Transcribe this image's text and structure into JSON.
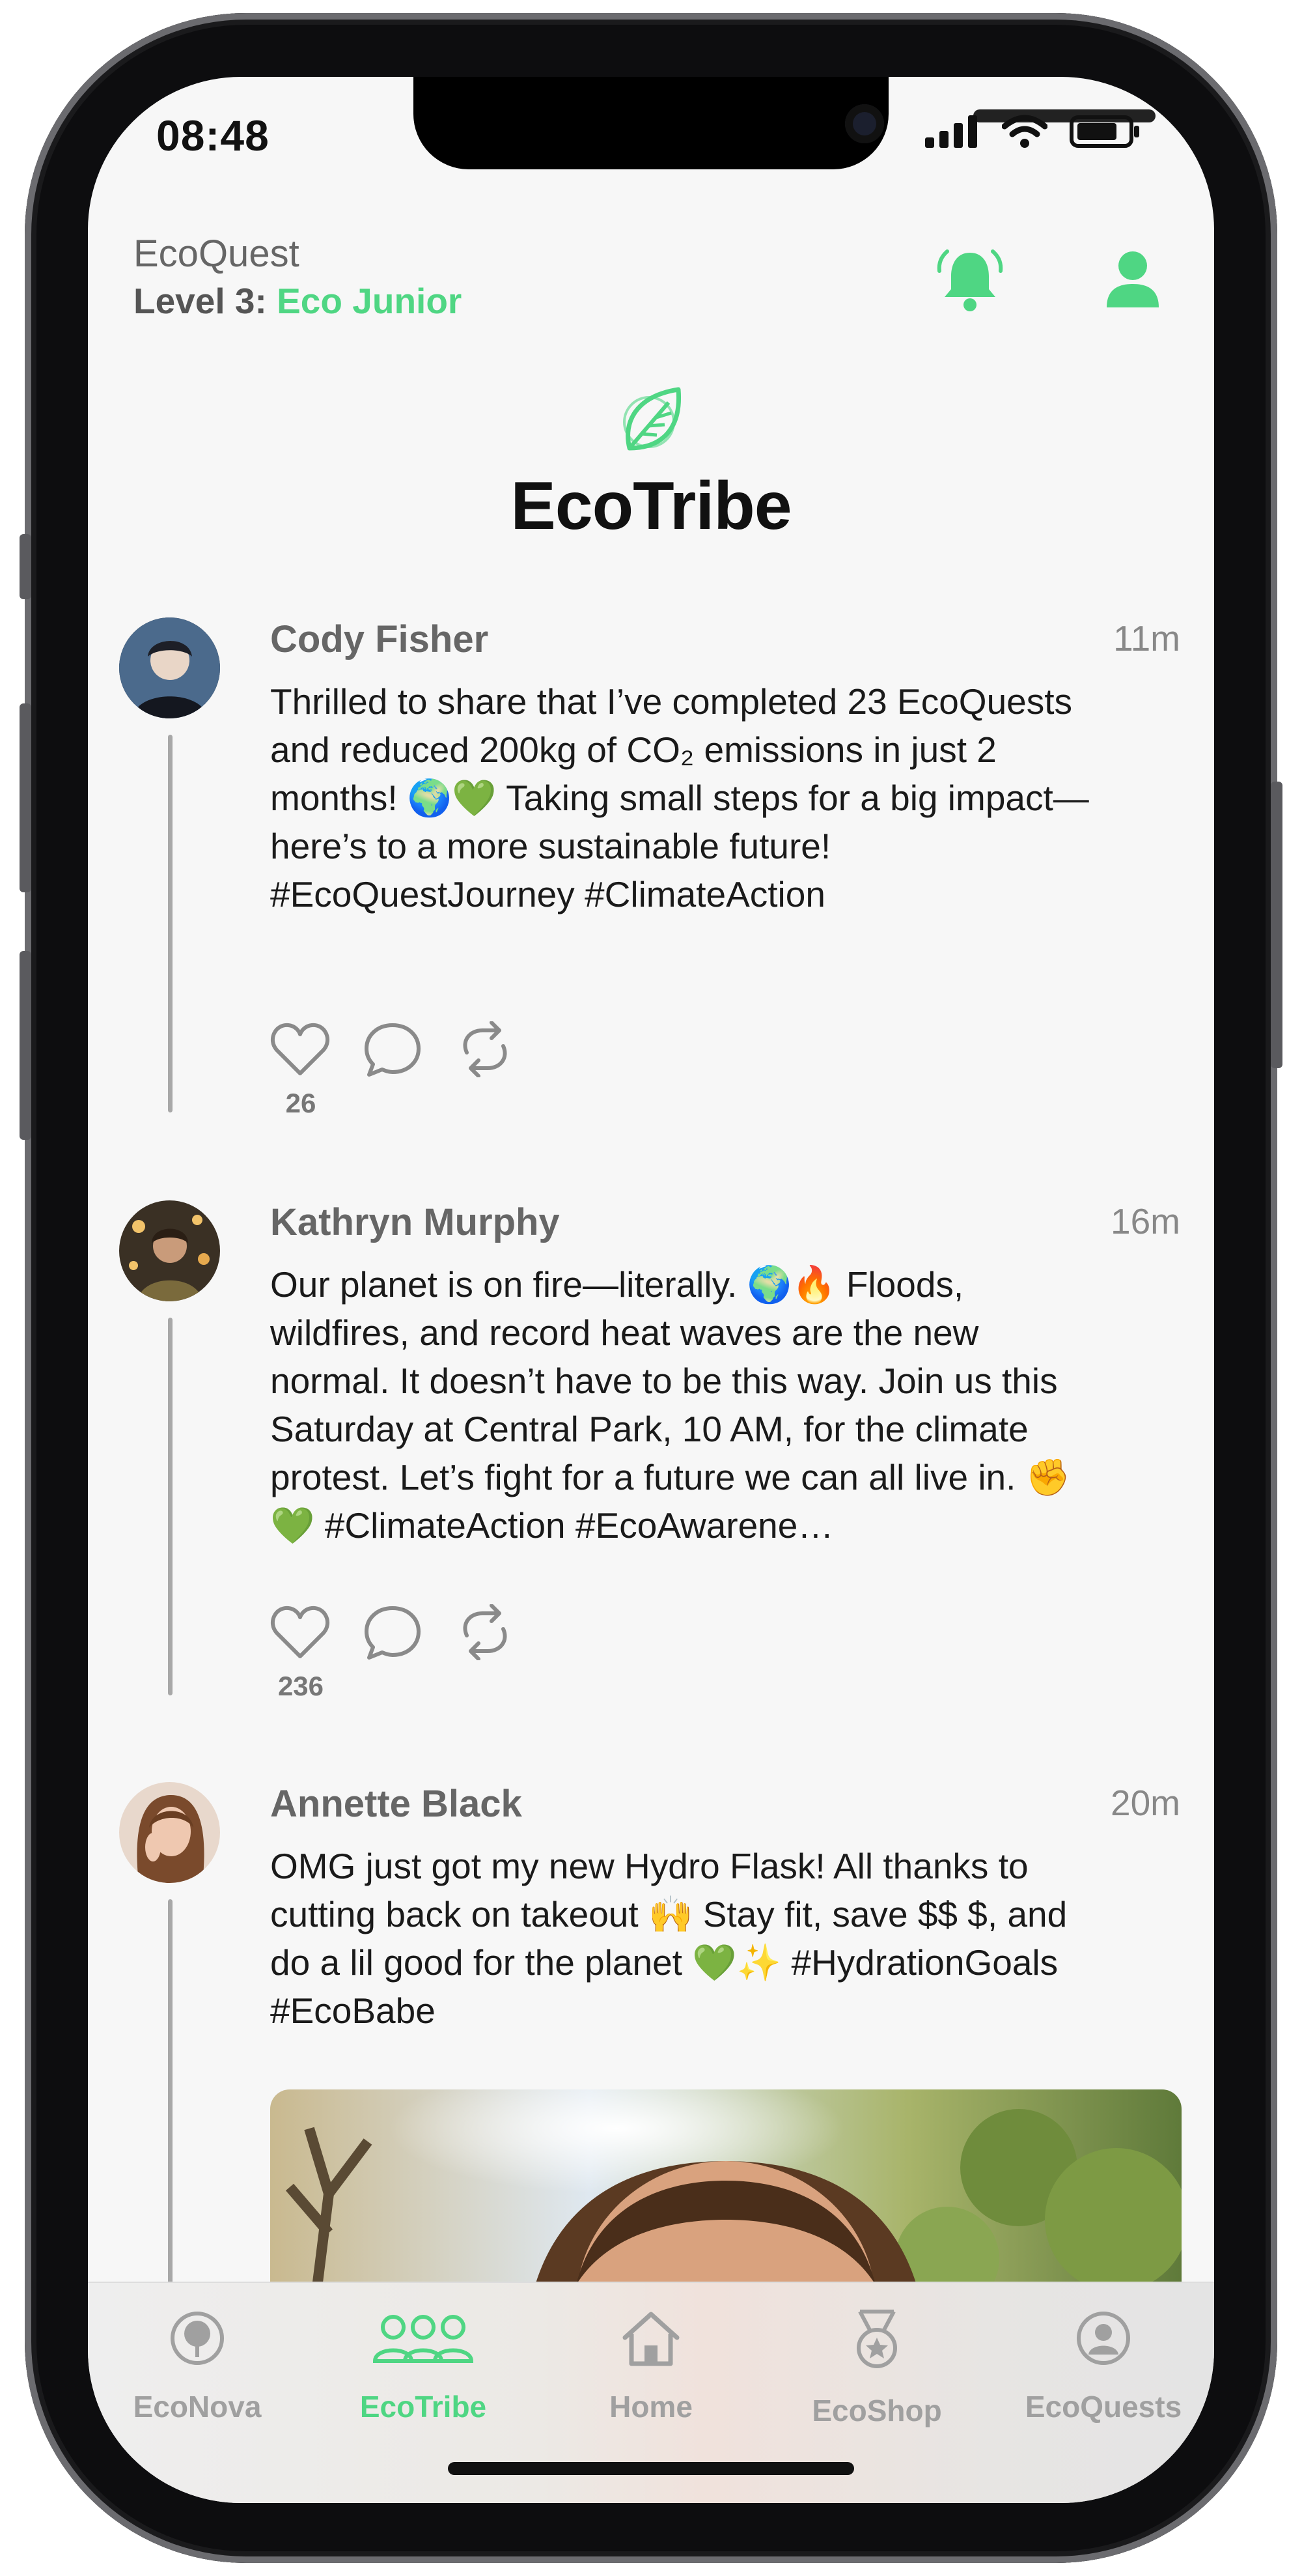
{
  "status_bar": {
    "time": "08:48"
  },
  "header": {
    "app_name": "EcoQuest",
    "level_prefix": "Level 3:",
    "level_name": "Eco Junior"
  },
  "brand": {
    "title": "EcoTribe"
  },
  "posts": [
    {
      "author": "Cody Fisher",
      "time": "11m",
      "text": "Thrilled to share that I’ve completed 23 EcoQuests and reduced 200kg of CO₂ emissions in just 2 months! 🌍💚 Taking small steps for a big impact—here’s to a more sustainable future! #EcoQuestJourney #ClimateAction",
      "likes": "26"
    },
    {
      "author": "Kathryn Murphy",
      "time": "16m",
      "text": "Our planet is on fire—literally. 🌍🔥 Floods, wildfires, and record heat waves are the new normal. It doesn’t have to be this way. Join us this Saturday at Central Park, 10 AM, for the climate protest. Let’s fight for a future we can all live in. ✊💚 #ClimateAction #EcoAwarene…",
      "likes": "236"
    },
    {
      "author": "Annette Black",
      "time": "20m",
      "text": "OMG just got my new Hydro Flask! All thanks to cutting back on takeout 🙌 Stay fit, save $$ $, and do a lil good for the planet 💚✨ #HydrationGoals #EcoBabe"
    }
  ],
  "tabs": [
    {
      "label": "EcoNova",
      "icon": "tree-icon",
      "active": false
    },
    {
      "label": "EcoTribe",
      "icon": "group-icon",
      "active": true
    },
    {
      "label": "Home",
      "icon": "home-icon",
      "active": false
    },
    {
      "label": "EcoShop",
      "icon": "medal-icon",
      "active": false
    },
    {
      "label": "EcoQuests",
      "icon": "profile-circle-icon",
      "active": false
    }
  ],
  "colors": {
    "accent": "#4fd683",
    "background": "#f7f7f7",
    "text": "#1a1a1a",
    "muted": "#888888"
  }
}
